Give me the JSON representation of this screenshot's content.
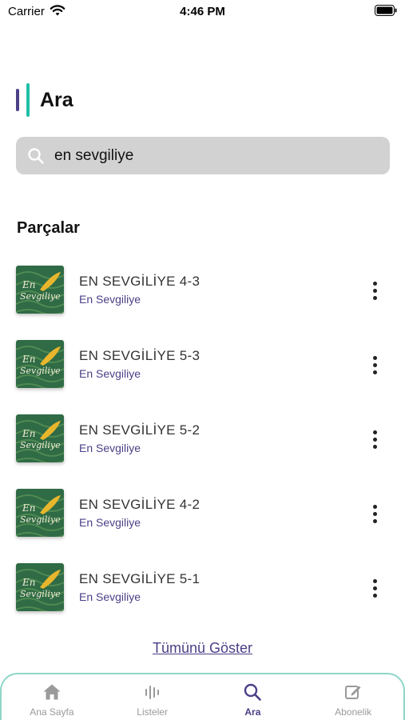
{
  "status_bar": {
    "carrier": "Carrier",
    "time": "4:46 PM"
  },
  "header": {
    "title": "Ara"
  },
  "search": {
    "value": "en sevgiliye",
    "icon": "search-icon"
  },
  "section": {
    "title": "Parçalar"
  },
  "tracks": [
    {
      "title": "EN SEVGİLİYE 4-3",
      "artist": "En Sevgiliye"
    },
    {
      "title": "EN SEVGİLİYE 5-3",
      "artist": "En Sevgiliye"
    },
    {
      "title": "EN SEVGİLİYE 5-2",
      "artist": "En Sevgiliye"
    },
    {
      "title": "EN SEVGİLİYE 4-2",
      "artist": "En Sevgiliye"
    },
    {
      "title": "EN SEVGİLİYE 5-1",
      "artist": "En Sevgiliye"
    }
  ],
  "show_all": "Tümünü Göster",
  "tabbar": {
    "tabs": [
      {
        "label": "Ana Sayfa",
        "icon": "home-icon",
        "active": false
      },
      {
        "label": "Listeler",
        "icon": "equalizer-icon",
        "active": false
      },
      {
        "label": "Ara",
        "icon": "search-icon",
        "active": true
      },
      {
        "label": "Abonelik",
        "icon": "edit-icon",
        "active": false
      }
    ]
  },
  "colors": {
    "accent_purple": "#4b3f87",
    "accent_teal": "#20c0a6",
    "search_bg": "#d2d2d2",
    "tab_inactive": "#9a9a9a"
  }
}
